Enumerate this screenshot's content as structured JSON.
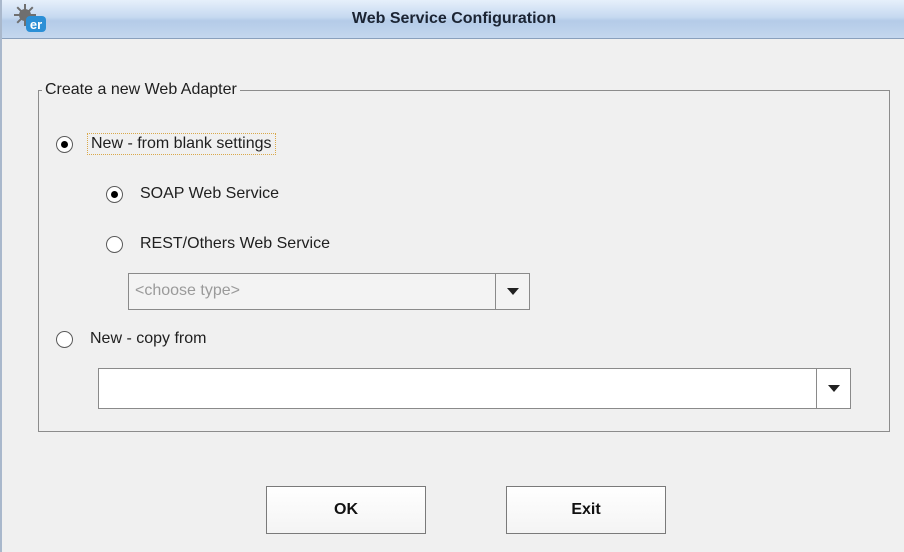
{
  "window": {
    "title": "Web Service Configuration",
    "icon": "er-gear-logo"
  },
  "group": {
    "legend": "Create a new Web Adapter"
  },
  "options": {
    "new_blank": {
      "label": "New - from blank settings",
      "checked": true
    },
    "soap": {
      "label": "SOAP Web Service",
      "checked": true
    },
    "rest": {
      "label": "REST/Others Web Service",
      "checked": false
    },
    "copy_from": {
      "label": "New - copy from",
      "checked": false
    }
  },
  "type_select": {
    "placeholder": "<choose type>",
    "enabled": false
  },
  "copy_select": {
    "value": ""
  },
  "buttons": {
    "ok": "OK",
    "exit": "Exit"
  },
  "colors": {
    "titlebar": "#c6d9f0",
    "background": "#f0f0f0",
    "focus_outline": "#d9a84a"
  }
}
